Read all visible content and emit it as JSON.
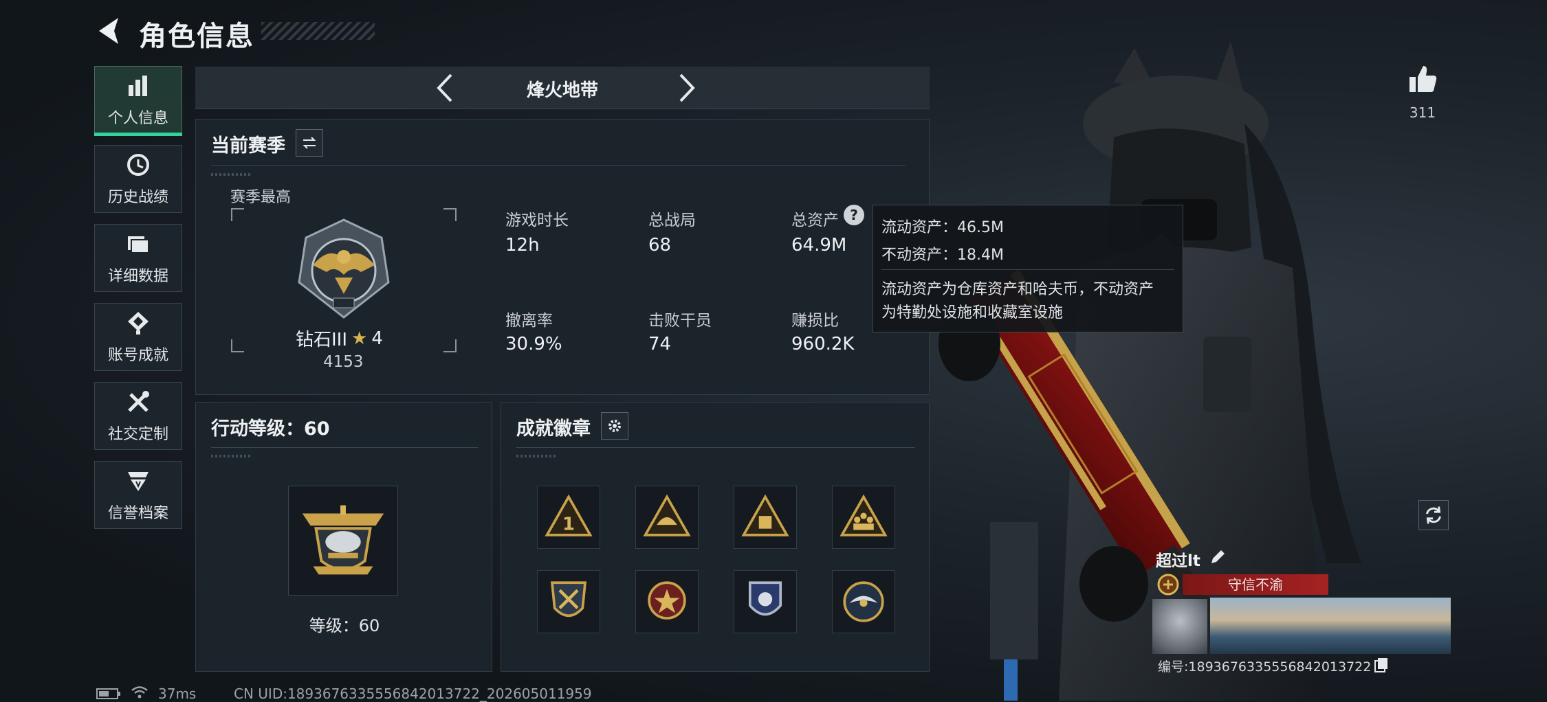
{
  "header": {
    "title": "角色信息"
  },
  "sidebar": {
    "items": [
      {
        "label": "个人信息",
        "icon": "bar-chart-icon",
        "active": true
      },
      {
        "label": "历史战绩",
        "icon": "history-icon"
      },
      {
        "label": "详细数据",
        "icon": "folder-icon"
      },
      {
        "label": "账号成就",
        "icon": "achievement-icon"
      },
      {
        "label": "社交定制",
        "icon": "tools-icon"
      },
      {
        "label": "信誉档案",
        "icon": "credit-icon"
      }
    ]
  },
  "map_selector": {
    "name": "烽火地带"
  },
  "season": {
    "title": "当前赛季",
    "best_label": "赛季最高",
    "rank_name": "钻石III",
    "rank_stars": "4",
    "rank_score": "4153",
    "stats": [
      {
        "label": "游戏时长",
        "value": "12h"
      },
      {
        "label": "总战局",
        "value": "68"
      },
      {
        "label": "总资产",
        "value": "64.9M"
      },
      {
        "label": "撤离率",
        "value": "30.9%"
      },
      {
        "label": "击败干员",
        "value": "74"
      },
      {
        "label": "赚损比",
        "value": "960.2K"
      }
    ]
  },
  "tooltip": {
    "liquid": "流动资产：46.5M",
    "fixed": "不动资产：18.4M",
    "desc_line1": "流动资产为仓库资产和哈夫币，不动资产",
    "desc_line2": "为特勤处设施和收藏室设施"
  },
  "action_level": {
    "title": "行动等级：60",
    "level_text": "等级：60"
  },
  "achievements": {
    "title": "成就徽章",
    "badges": [
      "triangle-number-one-badge",
      "triangle-helmet-badge",
      "triangle-crate-badge",
      "triangle-squad-badge",
      "shield-crossed-badge",
      "star-medal-badge",
      "police-shield-badge",
      "eagle-round-badge"
    ]
  },
  "likes": {
    "count": "311"
  },
  "player_card": {
    "name": "超过lt",
    "title_tag": "守信不渝",
    "id_line": "编号:1893676335556842013722"
  },
  "status_bar": {
    "ping": "37ms",
    "uid": "CN UID:1893676335556842013722_202605011959"
  },
  "colors": {
    "accent": "#34d39a",
    "tag_red": "#8e1c1c",
    "gold": "#c9a24a"
  }
}
